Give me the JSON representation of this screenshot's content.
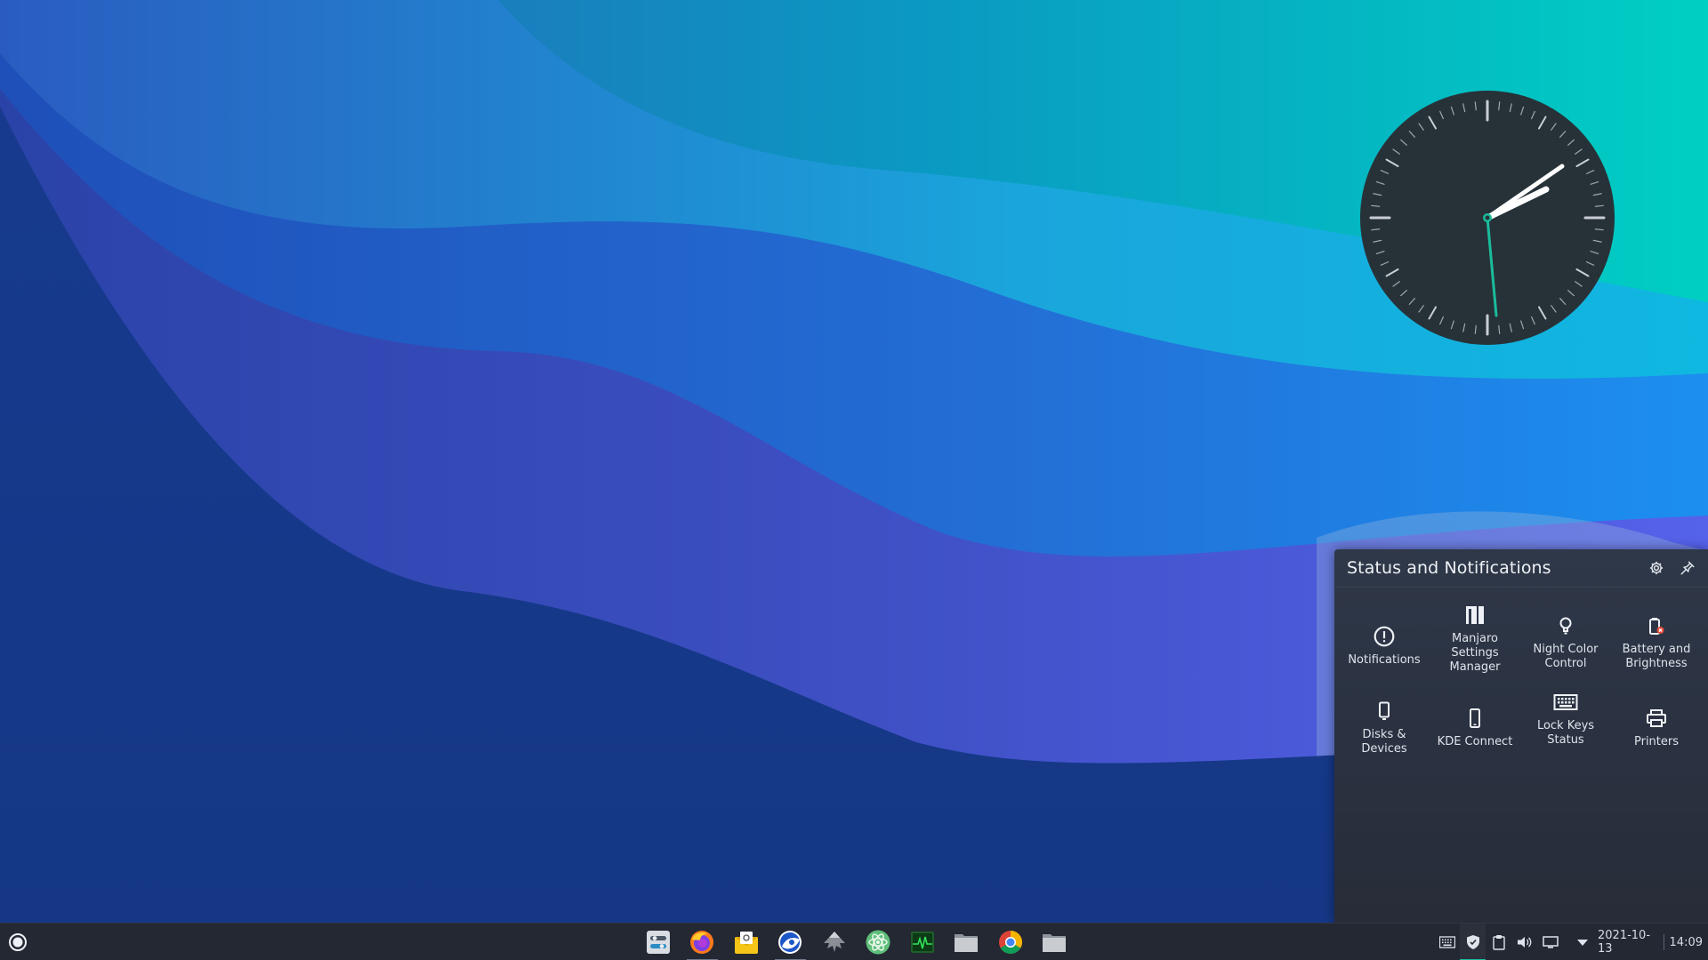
{
  "popup": {
    "title": "Status and Notifications",
    "items": [
      {
        "label": "Notifications",
        "icon": "exclamation-circle-icon"
      },
      {
        "label": "Manjaro Settings Manager",
        "icon": "manjaro-logo-icon"
      },
      {
        "label": "Night Color Control",
        "icon": "lightbulb-icon"
      },
      {
        "label": "Battery and Brightness",
        "icon": "battery-icon"
      },
      {
        "label": "Disks & Devices",
        "icon": "removable-drive-icon"
      },
      {
        "label": "KDE Connect",
        "icon": "smartphone-icon"
      },
      {
        "label": "Lock Keys Status",
        "icon": "keyboard-icon"
      },
      {
        "label": "Printers",
        "icon": "printer-icon"
      }
    ]
  },
  "clock": {
    "time": "14:09",
    "date": "2021-10-13"
  },
  "taskbar": {
    "apps": [
      "system-settings-icon",
      "firefox-icon",
      "mail-client-icon",
      "browser-icon",
      "inkscape-icon",
      "atom-icon",
      "system-monitor-icon",
      "file-manager-icon",
      "chrome-icon",
      "folder-icon"
    ],
    "tray_icons": [
      "keyboard-icon",
      "shield-icon",
      "clipboard-icon",
      "volume-icon",
      "display-icon"
    ]
  },
  "colors": {
    "accent": "#1abc9c",
    "panel": "#232833",
    "popup": "#2b3343"
  }
}
